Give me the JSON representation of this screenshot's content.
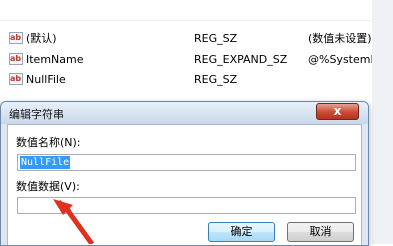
{
  "registry": {
    "rows": [
      {
        "name": "(默认)",
        "type": "REG_SZ",
        "data": "(数值未设置)"
      },
      {
        "name": "ItemName",
        "type": "REG_EXPAND_SZ",
        "data": "@%SystemR"
      },
      {
        "name": "NullFile",
        "type": "REG_SZ",
        "data": ""
      }
    ],
    "icon": "registry-string-icon",
    "icon_glyph": "ab"
  },
  "dialog": {
    "title": "编辑字符串",
    "close_glyph": "x",
    "value_name_label": "数值名称(N):",
    "value_name": "NullFile",
    "value_data_label": "数值数据(V):",
    "value_data": "",
    "ok_label": "确定",
    "cancel_label": "取消"
  },
  "colors": {
    "close_button": "#c94a34",
    "selection": "#3399ff",
    "arrow": "#e0301e"
  }
}
